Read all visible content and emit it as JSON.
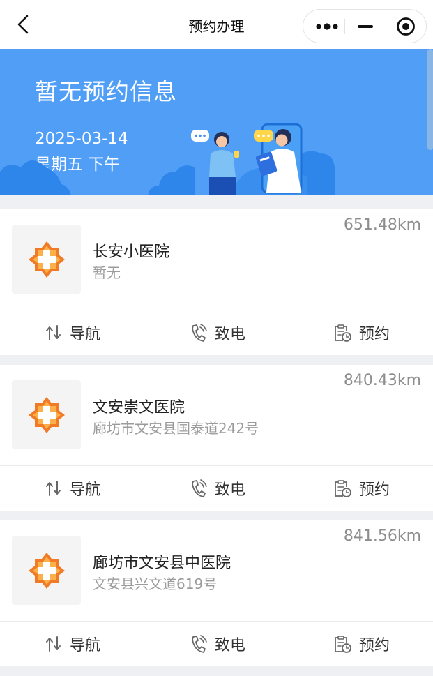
{
  "nav": {
    "title": "预约办理",
    "back_icon": "chevron-left-icon",
    "more_icon": "more-dots-icon",
    "minimize_icon": "minimize-icon",
    "close_icon": "target-close-icon"
  },
  "banner": {
    "title": "暂无预约信息",
    "date": "2025-03-14",
    "weekday": "星期五 下午",
    "background": "#519ef7"
  },
  "hospitals": [
    {
      "distance": "651.48km",
      "name": "长安小医院",
      "address": "暂无"
    },
    {
      "distance": "840.43km",
      "name": "文安崇文医院",
      "address": "廊坊市文安县国泰道242号"
    },
    {
      "distance": "841.56km",
      "name": "廊坊市文安县中医院",
      "address": "文安县兴文道619号"
    }
  ],
  "actions": {
    "navigate": "导航",
    "call": "致电",
    "book": "预约"
  },
  "colors": {
    "accent": "#519ef7",
    "logo_orange": "#f07a26",
    "page_bg": "#eef0f4"
  }
}
